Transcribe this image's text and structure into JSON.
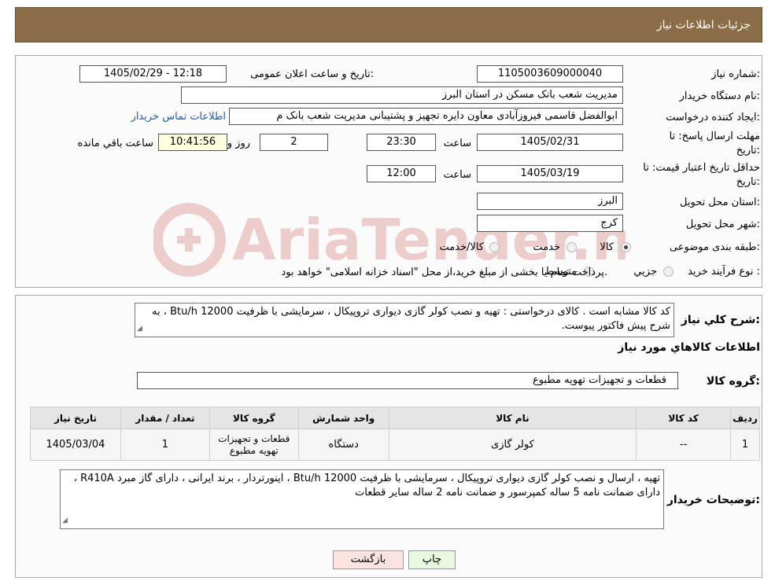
{
  "header": {
    "title": "جزئیات اطلاعات نیاز"
  },
  "form": {
    "need_number": {
      "label": "شماره نیاز:",
      "value": "1105003609000040"
    },
    "announce_datetime": {
      "label": "تاریخ و ساعت اعلان عمومی:",
      "value": "1405/02/29 - 12:18"
    },
    "buyer_org": {
      "label": "نام دستگاه خریدار:",
      "value": "مدیریت شعب بانک مسکن در استان البرز"
    },
    "requester": {
      "label": "ایجاد کننده درخواست:",
      "value": "ابوالفضل قاسمی فیروزآبادی معاون دایره تجهیز و پشتیبانی مدیریت شعب بانک م",
      "link": "اطلاعات تماس خریدار"
    },
    "reply_deadline": {
      "label_line1": "مهلت ارسال پاسخ: تا",
      "label_line2": "تاریخ:",
      "date": "1405/02/31",
      "time_label": "ساعت",
      "time": "23:30",
      "days": "2",
      "days_label": "روز و",
      "remaining": "10:41:56",
      "remaining_label": "ساعت باقي مانده"
    },
    "price_validity": {
      "label_line1": "حداقل تاریخ اعتبار قیمت: تا",
      "label_line2": "تاریخ:",
      "date": "1405/03/19",
      "time_label": "ساعت",
      "time": "12:00"
    },
    "delivery_province": {
      "label": "استان محل تحویل:",
      "value": "البرز"
    },
    "delivery_city": {
      "label": "شهر محل تحویل:",
      "value": "کرج"
    },
    "category": {
      "label": "طبقه بندی موضوعی:",
      "options": [
        "کالا",
        "خدمت",
        "کالا/خدمت"
      ],
      "selected": "کالا"
    },
    "purchase_type": {
      "label": "نوع فرآیند خرید :",
      "options": [
        "جزیي",
        "متوسط"
      ],
      "note": "پرداخت تمام یا بخشی از مبلغ خرید،از محل \"اسناد خزانه اسلامی\" خواهد بود."
    }
  },
  "summary": {
    "label": "شرح کلي نياز:",
    "text": "کد کالا مشابه است . کالای درخواستی : تهیه و نصب کولر گازی دیواری تروپیکال ، سرمایشی با ظرفیت Btu/h 12000 ، به شرح پیش فاکتور پیوست."
  },
  "goods_section": {
    "title": "اطلاعات کالاهاي مورد نياز",
    "group_label": "گروه کالا:",
    "group_value": "قطعات و تجهیزات تهویه مطبوع"
  },
  "table": {
    "headers": [
      "رديف",
      "کد کالا",
      "نام کالا",
      "واحد شمارش",
      "گروه کالا",
      "تعداد / مقدار",
      "تاريخ نياز"
    ],
    "rows": [
      [
        "1",
        "--",
        "کولر گازی",
        "دستگاه",
        "قطعات و تجهیزات تهویه مطبوع",
        "1",
        "1405/03/04"
      ]
    ]
  },
  "buyer_notes": {
    "label": "توضیحات خریدار:",
    "text": "تهیه ، ارسال و نصب کولر گازی دیواری تروپیکال ، سرمایشی با ظرفیت Btu/h 12000 ، اینورتردار ، برند ایرانی ، دارای گاز مبرد R410A ، دارای ضمانت نامه 5 ساله کمپرسور و ضمانت نامه 2 ساله سایر قطعات"
  },
  "buttons": {
    "print": "چاپ",
    "back": "بازگشت"
  },
  "watermark": {
    "text": "AriaTender.neT"
  },
  "colors": {
    "header_bg": "#8b6e47",
    "link": "#1a5fb4",
    "yellow_box": "#ffffe0",
    "back_button": "#fde2e2",
    "print_button": "#e8f8e0"
  }
}
